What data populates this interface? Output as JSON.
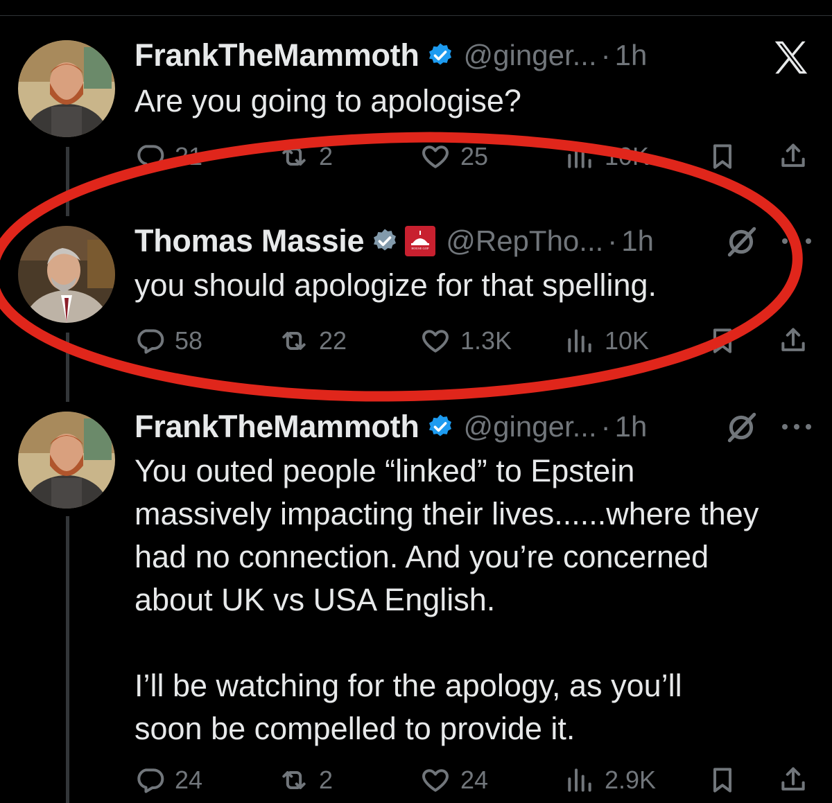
{
  "tweets": [
    {
      "name": "FrankTheMammoth",
      "handle": "@ginger...",
      "separator": "·",
      "time": "1h",
      "text": "Are you going to apologise?",
      "replies": "21",
      "reposts": "2",
      "likes": "25",
      "views": "10K"
    },
    {
      "name": "Thomas Massie",
      "handle": "@RepTho...",
      "separator": "·",
      "time": "1h",
      "text": "you should apologize for that spelling.",
      "replies": "58",
      "reposts": "22",
      "likes": "1.3K",
      "views": "10K",
      "affiliation_badge_text": "HOUSE GOP"
    },
    {
      "name": "FrankTheMammoth",
      "handle": "@ginger...",
      "separator": "·",
      "time": "1h",
      "text": "You outed people “linked” to Epstein\nmassively impacting their lives......where they\nhad no connection. And you’re concerned\nabout UK vs USA English.\n\nI’ll be watching for the apology, as you’ll\nsoon be compelled to provide it.",
      "replies": "24",
      "reposts": "2",
      "likes": "24",
      "views": "2.9K"
    }
  ],
  "colors": {
    "background": "#000000",
    "text": "#e7e9ea",
    "muted": "#71767b",
    "verified": "#1d9bf0",
    "highlight_ellipse": "#e0261b",
    "house_badge": "#c8202f"
  },
  "icons": {
    "close": "x-logo-icon",
    "reply": "reply-bubble-icon",
    "repost": "repost-icon",
    "like": "heart-icon",
    "views": "views-bar-chart-icon",
    "bookmark": "bookmark-icon",
    "share": "share-upload-icon",
    "grok": "grok-icon",
    "more": "more-dots-icon"
  }
}
